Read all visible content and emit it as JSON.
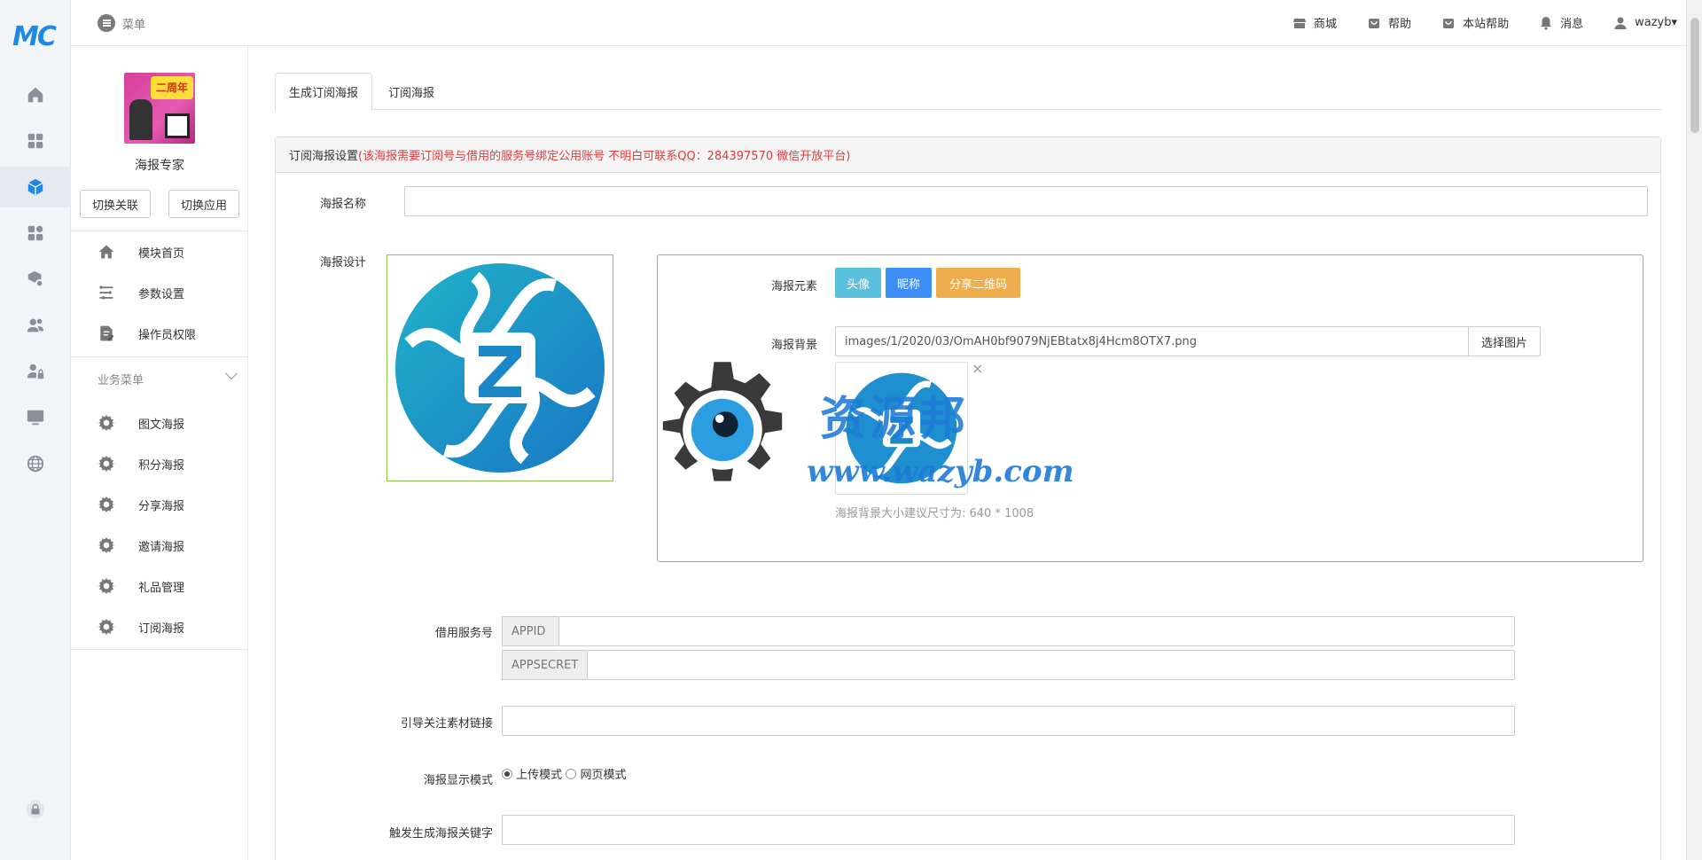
{
  "brand": {
    "logo_text": "MC",
    "accent": "#1e88e5"
  },
  "rail": {
    "icons": [
      "home-icon",
      "grid-icon",
      "cube-icon",
      "apps-icon",
      "app-settings-icon",
      "users-icon",
      "user-lock-icon",
      "monitor-icon",
      "globe-icon",
      "lock-icon"
    ],
    "active_index": 2
  },
  "header": {
    "menu_label": "菜单",
    "links": [
      {
        "icon": "store-icon",
        "label": "商城"
      },
      {
        "icon": "bag-icon",
        "label": "帮助"
      },
      {
        "icon": "bag-icon",
        "label": "本站帮助"
      },
      {
        "icon": "bell-icon",
        "label": "消息"
      },
      {
        "icon": "user-icon",
        "label": "wazyb▾"
      }
    ]
  },
  "sidebar": {
    "thumb_text": "二周年",
    "app_name": "海报专家",
    "switch_link_label": "切换关联",
    "switch_app_label": "切换应用",
    "top_items": [
      {
        "icon": "home-icon",
        "label": "模块首页"
      },
      {
        "icon": "sliders-icon",
        "label": "参数设置"
      },
      {
        "icon": "doc-edit-icon",
        "label": "操作员权限"
      }
    ],
    "section_label": "业务菜单",
    "biz_items": [
      {
        "icon": "gear-icon",
        "label": "图文海报"
      },
      {
        "icon": "gear-icon",
        "label": "积分海报"
      },
      {
        "icon": "gear-icon",
        "label": "分享海报"
      },
      {
        "icon": "gear-icon",
        "label": "邀请海报"
      },
      {
        "icon": "gear-icon",
        "label": "礼品管理"
      },
      {
        "icon": "gear-icon",
        "label": "订阅海报"
      }
    ]
  },
  "tabs": [
    {
      "label": "生成订阅海报",
      "active": true
    },
    {
      "label": "订阅海报",
      "active": false
    }
  ],
  "panel": {
    "head_title": "订阅海报设置",
    "head_warning": "(该海报需要订阅号与借用的服务号绑定公用账号 不明白可联系QQ：284397570 微信开放平台)"
  },
  "form": {
    "poster_name_label": "海报名称",
    "poster_name_value": "",
    "poster_design_label": "海报设计",
    "elements_label": "海报元素",
    "element_buttons": [
      {
        "label": "头像",
        "color": "#5bc0de"
      },
      {
        "label": "昵称",
        "color": "#3d8ef8"
      },
      {
        "label": "分享二维码",
        "color": "#f0ad4e"
      }
    ],
    "background_label": "海报背景",
    "background_value": "images/1/2020/03/OmAH0bf9079NjEBtatx8j4Hcm8OTX7.png",
    "pick_image_label": "选择图片",
    "remove_mark": "×",
    "background_hint": "海报背景大小建议尺寸为: 640 * 1008",
    "service_label": "借用服务号",
    "appid_addon": "APPID",
    "appsecret_addon": "APPSECRET",
    "guide_link_label": "引导关注素材链接",
    "display_mode_label": "海报显示模式",
    "mode_upload": "上传模式",
    "mode_web": "网页模式",
    "keyword_label": "触发生成海报关键字"
  },
  "watermark": {
    "text": "资源邦",
    "url": "www.wazyb.com"
  }
}
